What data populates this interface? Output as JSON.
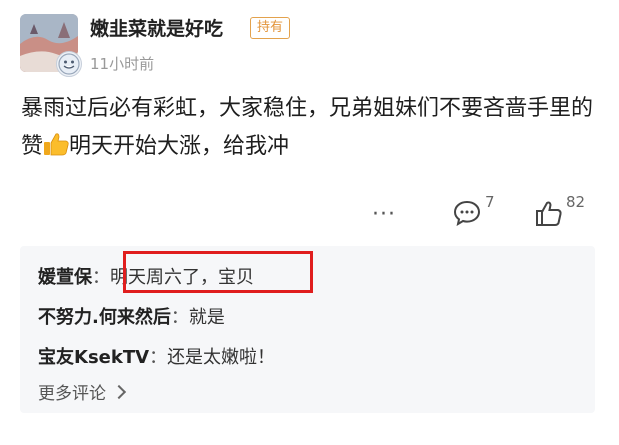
{
  "post": {
    "username": "嫩韭菜就是好吃",
    "tag": "持有",
    "time": "11小时前",
    "content_part1": "暴雨过后必有彩虹，大家稳住，兄弟姐妹们不要吝啬手里的赞",
    "content_emoji": "thumbs-up-emoji",
    "content_part2": "明天开始大涨，给我冲",
    "more_icon": "more-dots-icon",
    "comment_count": "7",
    "like_count": "82"
  },
  "comments": {
    "rows": [
      {
        "name": "媛萱保",
        "separator": "：",
        "text": "明天周六了，宝贝"
      },
      {
        "name": "不努力.何来然后",
        "separator": "：",
        "text": "就是"
      },
      {
        "name": "宝友KsekTV",
        "separator": "：",
        "text": "还是太嫩啦！"
      }
    ],
    "more_label": "更多评论"
  },
  "colors": {
    "tag": "#e3953b",
    "highlight": "#e01e1e",
    "comment_bg": "#f6f7f9"
  }
}
